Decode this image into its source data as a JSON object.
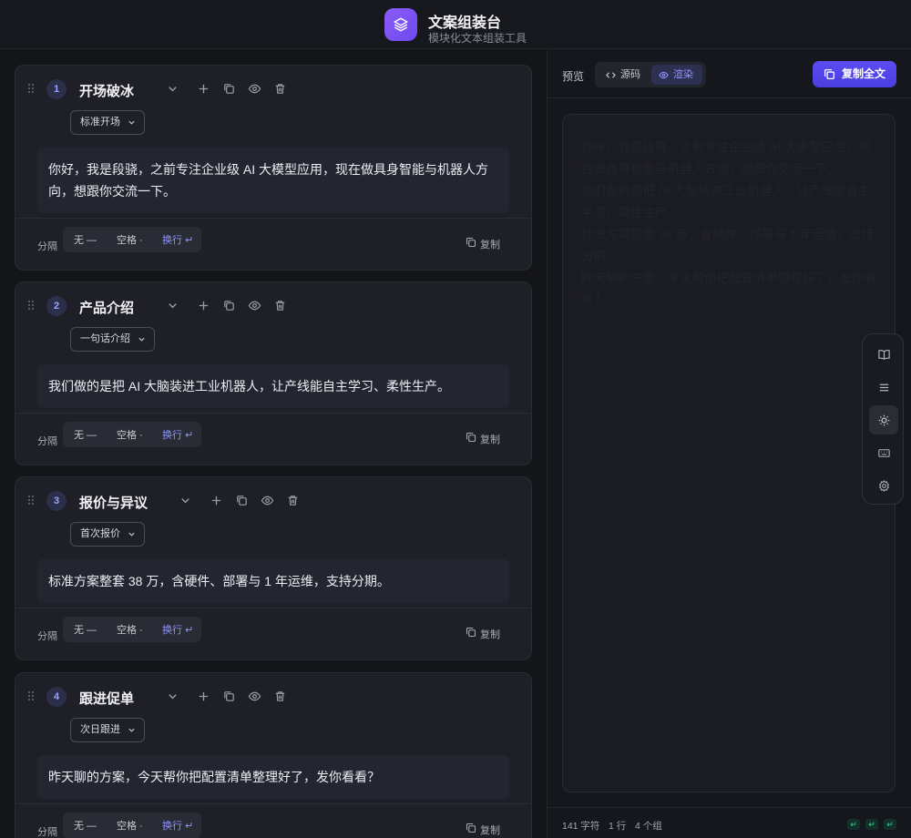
{
  "app": {
    "title": "文案组装台",
    "subtitle": "模块化文本组装工具"
  },
  "colors": {
    "accent": "#6d4af0",
    "active_option": "#8f95ff",
    "background": "#141519"
  },
  "blocks": [
    {
      "index": "1",
      "title": "开场破冰",
      "variant": "标准开场",
      "text": "你好，我是段骁，之前专注企业级 AI 大模型应用，现在做具身智能与机器人方向，想跟你交流一下。",
      "separator_label": "分隔",
      "separator_options": [
        "无 —",
        "空格 ·",
        "换行 ↵"
      ],
      "selected_separator": "换行 ↵",
      "copy_label": "复制"
    },
    {
      "index": "2",
      "title": "产品介绍",
      "variant": "一句话介绍",
      "text": "我们做的是把 AI 大脑装进工业机器人，让产线能自主学习、柔性生产。",
      "separator_label": "分隔",
      "separator_options": [
        "无 —",
        "空格 ·",
        "换行 ↵"
      ],
      "selected_separator": "换行 ↵",
      "copy_label": "复制"
    },
    {
      "index": "3",
      "title": "报价与异议",
      "variant": "首次报价",
      "text": "标准方案整套 38 万，含硬件、部署与 1 年运维，支持分期。",
      "separator_label": "分隔",
      "separator_options": [
        "无 —",
        "空格 ·",
        "换行 ↵"
      ],
      "selected_separator": "换行 ↵",
      "copy_label": "复制"
    },
    {
      "index": "4",
      "title": "跟进促单",
      "variant": "次日跟进",
      "text": "昨天聊的方案，今天帮你把配置清单整理好了，发你看看？",
      "separator_label": "分隔",
      "separator_options": [
        "无 —",
        "空格 ·",
        "换行 ↵"
      ],
      "selected_separator": "换行 ↵",
      "copy_label": "复制"
    }
  ],
  "preview": {
    "label": "预览",
    "modes": [
      "源码",
      "渲染"
    ],
    "active_mode": "渲染",
    "copy_all_label": "复制全文",
    "lines": [
      "你好，我是段骁，之前专注企业级 AI 大模型应用，现在做具身智能与机器人方向，想跟你交流一下。",
      "我们做的是把 AI 大脑装进工业机器人，让产线能自主学习、柔性生产。",
      "标准方案整套 38 万，含硬件、部署与 1 年运维，支持分期。",
      "昨天聊的方案，今天帮你把配置清单整理好了，发你看看？"
    ]
  },
  "status": {
    "chars": "141 字符",
    "lines": "1 行",
    "groups": "4 个组",
    "badges": [
      "↵",
      "↵",
      "↵"
    ]
  },
  "rail": {
    "icons": [
      "book-icon",
      "menu-lines-icon",
      "sun-icon",
      "keyboard-icon",
      "settings-gear-icon"
    ],
    "active": "sun-icon"
  }
}
